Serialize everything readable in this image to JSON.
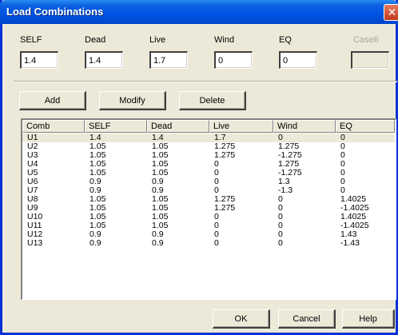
{
  "window": {
    "title": "Load Combinations",
    "close_label": "✕"
  },
  "fields": [
    {
      "label": "SELF",
      "value": "1.4",
      "enabled": true
    },
    {
      "label": "Dead",
      "value": "1.4",
      "enabled": true
    },
    {
      "label": "Live",
      "value": "1.7",
      "enabled": true
    },
    {
      "label": "Wind",
      "value": "0",
      "enabled": true
    },
    {
      "label": "EQ",
      "value": "0",
      "enabled": true
    },
    {
      "label": "Case6",
      "value": "",
      "enabled": false
    }
  ],
  "actions": {
    "add": "Add",
    "modify": "Modify",
    "delete": "Delete"
  },
  "list": {
    "columns": [
      "Comb",
      "SELF",
      "Dead",
      "Live",
      "Wind",
      "EQ"
    ],
    "selected_row": 0,
    "rows": [
      [
        "U1",
        "1.4",
        "1.4",
        "1.7",
        "0",
        "0"
      ],
      [
        "U2",
        "1.05",
        "1.05",
        "1.275",
        "1.275",
        "0"
      ],
      [
        "U3",
        "1.05",
        "1.05",
        "1.275",
        "-1.275",
        "0"
      ],
      [
        "U4",
        "1.05",
        "1.05",
        "0",
        "1.275",
        "0"
      ],
      [
        "U5",
        "1.05",
        "1.05",
        "0",
        "-1.275",
        "0"
      ],
      [
        "U6",
        "0.9",
        "0.9",
        "0",
        "1.3",
        "0"
      ],
      [
        "U7",
        "0.9",
        "0.9",
        "0",
        "-1.3",
        "0"
      ],
      [
        "U8",
        "1.05",
        "1.05",
        "1.275",
        "0",
        "1.4025"
      ],
      [
        "U9",
        "1.05",
        "1.05",
        "1.275",
        "0",
        "-1.4025"
      ],
      [
        "U10",
        "1.05",
        "1.05",
        "0",
        "0",
        "1.4025"
      ],
      [
        "U11",
        "1.05",
        "1.05",
        "0",
        "0",
        "-1.4025"
      ],
      [
        "U12",
        "0.9",
        "0.9",
        "0",
        "0",
        "1.43"
      ],
      [
        "U13",
        "0.9",
        "0.9",
        "0",
        "0",
        "-1.43"
      ]
    ]
  },
  "footer": {
    "ok": "OK",
    "cancel": "Cancel",
    "help": "Help"
  }
}
